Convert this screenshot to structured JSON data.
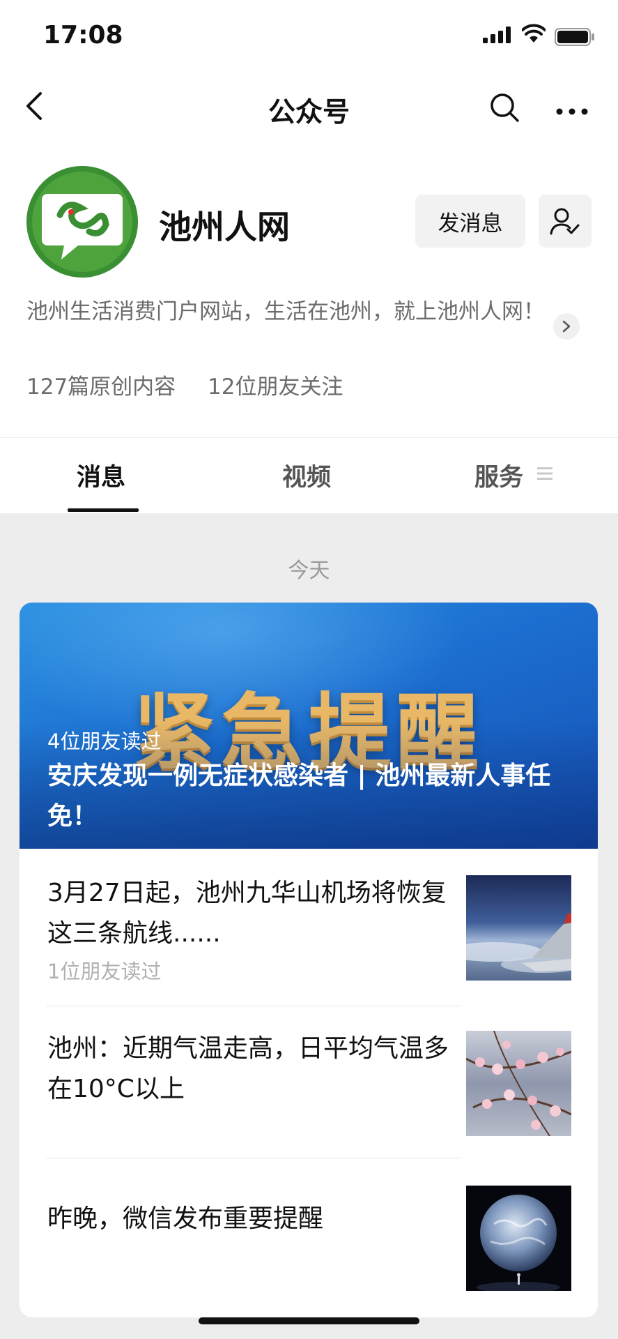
{
  "status_bar": {
    "time": "17:08"
  },
  "nav": {
    "title": "公众号"
  },
  "profile": {
    "name": "池州人网",
    "message_button": "发消息",
    "description": "池州生活消费门户网站，生活在池州，就上池州人网！",
    "stats": {
      "original_articles": "127篇原创内容",
      "friends_following": "12位朋友关注"
    }
  },
  "tabs": [
    {
      "label": "消息",
      "active": true
    },
    {
      "label": "视频",
      "active": false
    },
    {
      "label": "服务",
      "active": false
    }
  ],
  "feed": {
    "date_label": "今天",
    "banner": {
      "headline": "紧急提醒",
      "friends_read": "4位朋友读过",
      "title": "安庆发现一例无症状感染者 | 池州最新人事任免！"
    },
    "articles": [
      {
        "title": "3月27日起，池州九华山机场将恢复这三条航线......",
        "friends_read": "1位朋友读过"
      },
      {
        "title": "池州：近期气温走高，日平均气温多在10°C以上",
        "friends_read": ""
      },
      {
        "title": "昨晚，微信发布重要提醒",
        "friends_read": ""
      }
    ]
  },
  "colors": {
    "brand_green": "#3a8f32",
    "banner_blue": "#1c6fd0",
    "headline_gold": "#e8b867",
    "feed_background": "#ededed"
  }
}
